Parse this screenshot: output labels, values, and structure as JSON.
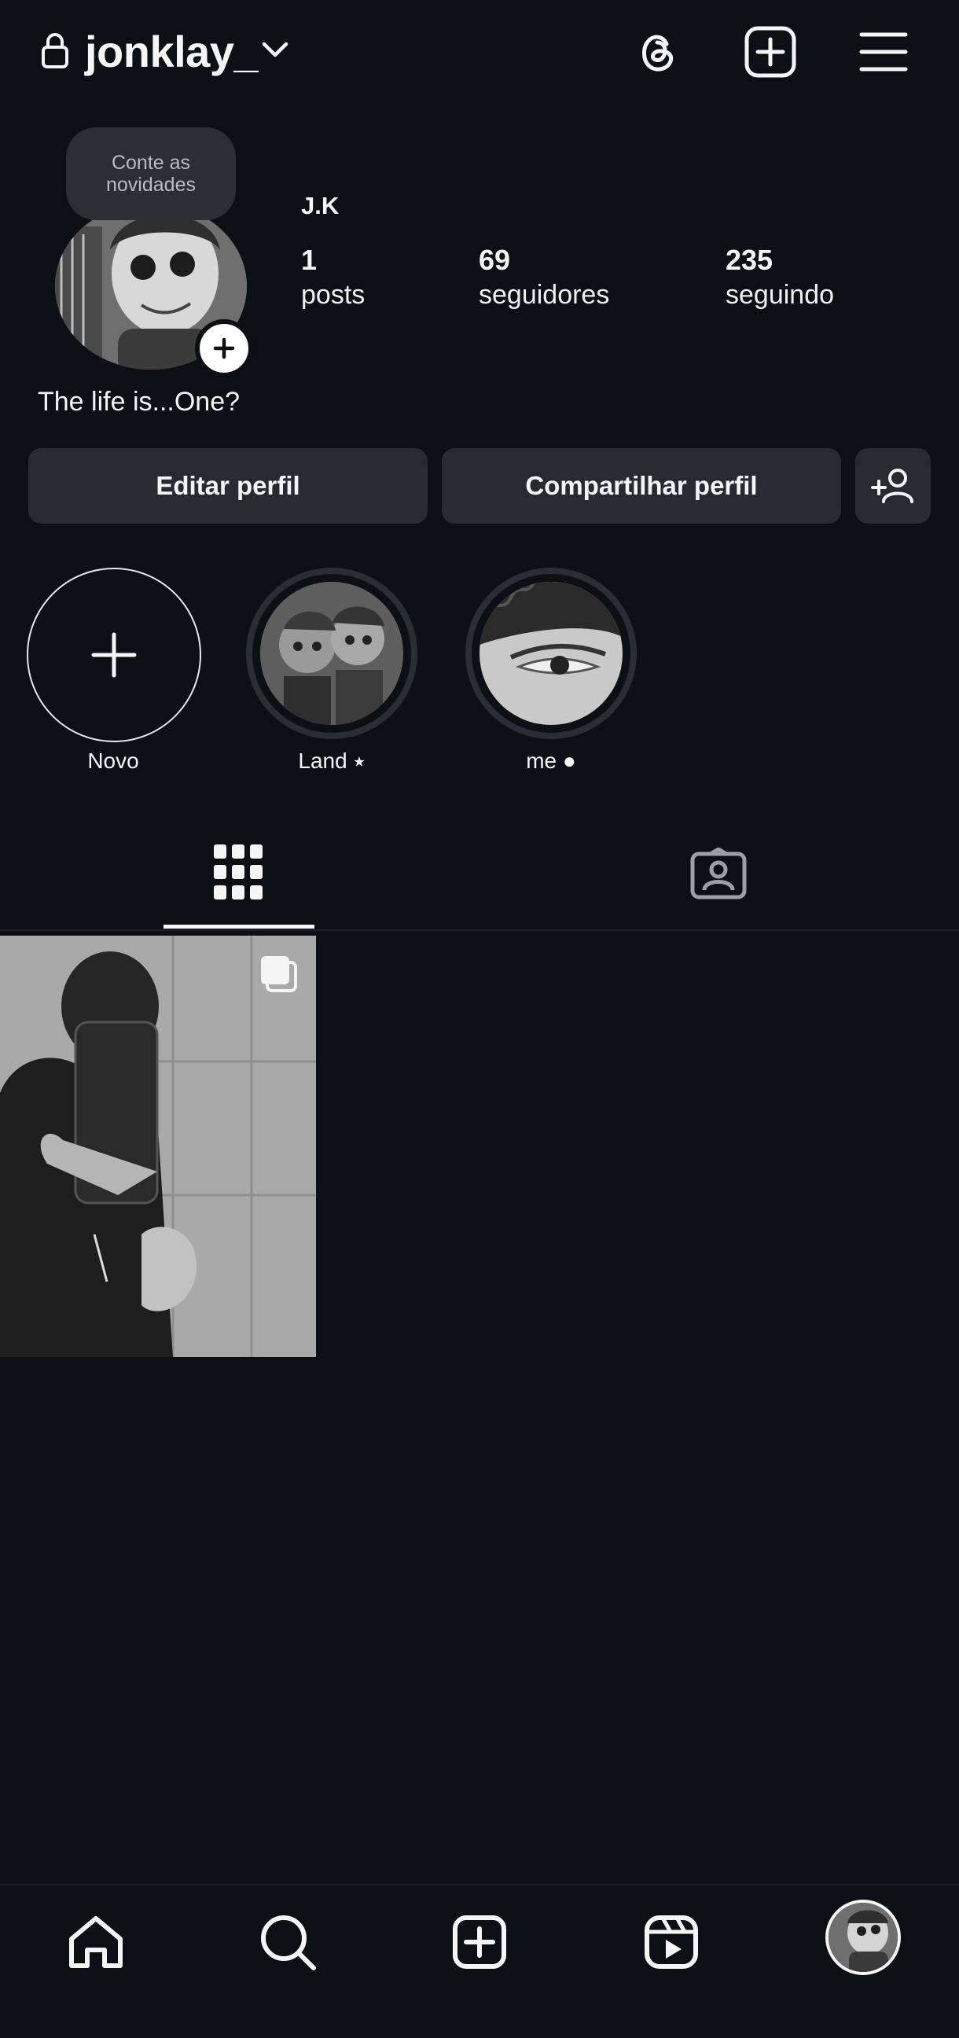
{
  "header": {
    "username": "jonklay_",
    "icons": [
      "lock-icon",
      "chevron-down-icon",
      "threads-icon",
      "create-post-icon",
      "menu-icon"
    ]
  },
  "profile": {
    "note": "Conte as novidades",
    "display_name": "J.K",
    "bio": "The life is...One?",
    "stats": [
      {
        "value": "1",
        "label": "posts"
      },
      {
        "value": "69",
        "label": "seguidores"
      },
      {
        "value": "235",
        "label": "seguindo"
      }
    ]
  },
  "actions": {
    "edit_label": "Editar perfil",
    "share_label": "Compartilhar perfil"
  },
  "highlights": [
    {
      "label": "Novo"
    },
    {
      "label": "Land ⭑"
    },
    {
      "label": "me ●"
    }
  ],
  "tabs": [
    "grid-icon",
    "tagged-icon"
  ],
  "nav": [
    "home-icon",
    "search-icon",
    "create-icon",
    "reels-icon",
    "profile-avatar"
  ],
  "colors": {
    "background": "#0c0f14",
    "button": "#272b31",
    "text": "#f5f5f5"
  }
}
